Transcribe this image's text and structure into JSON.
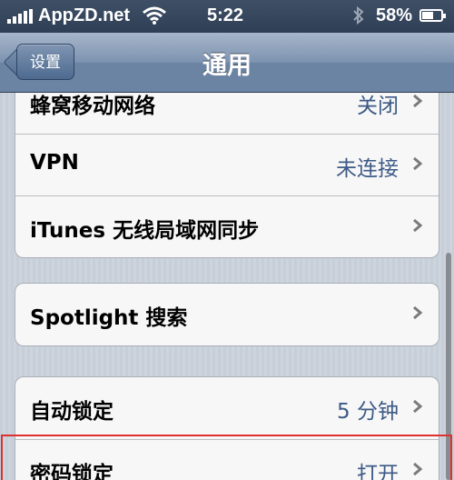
{
  "status_bar": {
    "carrier": "AppZD.net",
    "time": "5:22",
    "battery": "58%",
    "battery_level": 0.58,
    "icons": [
      "signal-icon",
      "wifi-icon",
      "bluetooth-icon",
      "battery-icon"
    ]
  },
  "nav": {
    "back_label": "设置",
    "title": "通用"
  },
  "groups": [
    {
      "rows": [
        {
          "label": "蜂窝移动网络",
          "value": "关闭"
        },
        {
          "label": "VPN",
          "value": "未连接"
        },
        {
          "label": "iTunes 无线局域网同步",
          "value": ""
        }
      ]
    },
    {
      "rows": [
        {
          "label": "Spotlight 搜索",
          "value": ""
        }
      ]
    },
    {
      "rows": [
        {
          "label": "自动锁定",
          "value": "5 分钟"
        },
        {
          "label": "密码锁定",
          "value": "打开"
        }
      ]
    }
  ],
  "colors": {
    "value_text": "#3d5a86",
    "highlight_border": "#e0302d"
  }
}
